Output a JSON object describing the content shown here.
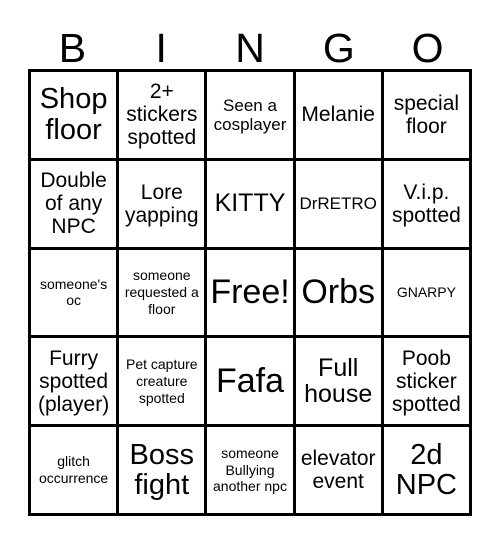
{
  "card": {
    "title": "BINGO",
    "background_color": "#ffffff",
    "line_color": "#000000",
    "text_color": "#000000"
  },
  "header": {
    "letters": [
      "B",
      "I",
      "N",
      "G",
      "O"
    ]
  },
  "grid": {
    "columns": 5,
    "rows": 5,
    "free_space_index": 12,
    "cells": [
      {
        "text": "Shop floor",
        "size": "fs-xl"
      },
      {
        "text": "2+ stickers spotted",
        "size": "fs-md"
      },
      {
        "text": "Seen a cosplayer",
        "size": "fs-sm"
      },
      {
        "text": "Melanie",
        "size": "fs-md"
      },
      {
        "text": "special floor",
        "size": "fs-md"
      },
      {
        "text": "Double of any NPC",
        "size": "fs-md"
      },
      {
        "text": "Lore yapping",
        "size": "fs-md"
      },
      {
        "text": "KITTY",
        "size": "fs-lg"
      },
      {
        "text": "DrRETRO",
        "size": "fs-sm"
      },
      {
        "text": "V.i.p. spotted",
        "size": "fs-md"
      },
      {
        "text": "someone's oc",
        "size": "fs-xs"
      },
      {
        "text": "someone requested a floor",
        "size": "fs-xs"
      },
      {
        "text": "Free!",
        "size": "fs-xxl"
      },
      {
        "text": "Orbs",
        "size": "fs-xxl"
      },
      {
        "text": "GNARPY",
        "size": "fs-xs"
      },
      {
        "text": "Furry spotted (player)",
        "size": "fs-md"
      },
      {
        "text": "Pet capture creature spotted",
        "size": "fs-xs"
      },
      {
        "text": "Fafa",
        "size": "fs-xxl"
      },
      {
        "text": "Full house",
        "size": "fs-lg"
      },
      {
        "text": "Poob sticker spotted",
        "size": "fs-md"
      },
      {
        "text": "glitch occurrence",
        "size": "fs-xs"
      },
      {
        "text": "Boss fight",
        "size": "fs-xl"
      },
      {
        "text": "someone Bullying another npc",
        "size": "fs-xs"
      },
      {
        "text": "elevator event",
        "size": "fs-md"
      },
      {
        "text": "2d NPC",
        "size": "fs-xl"
      }
    ]
  }
}
